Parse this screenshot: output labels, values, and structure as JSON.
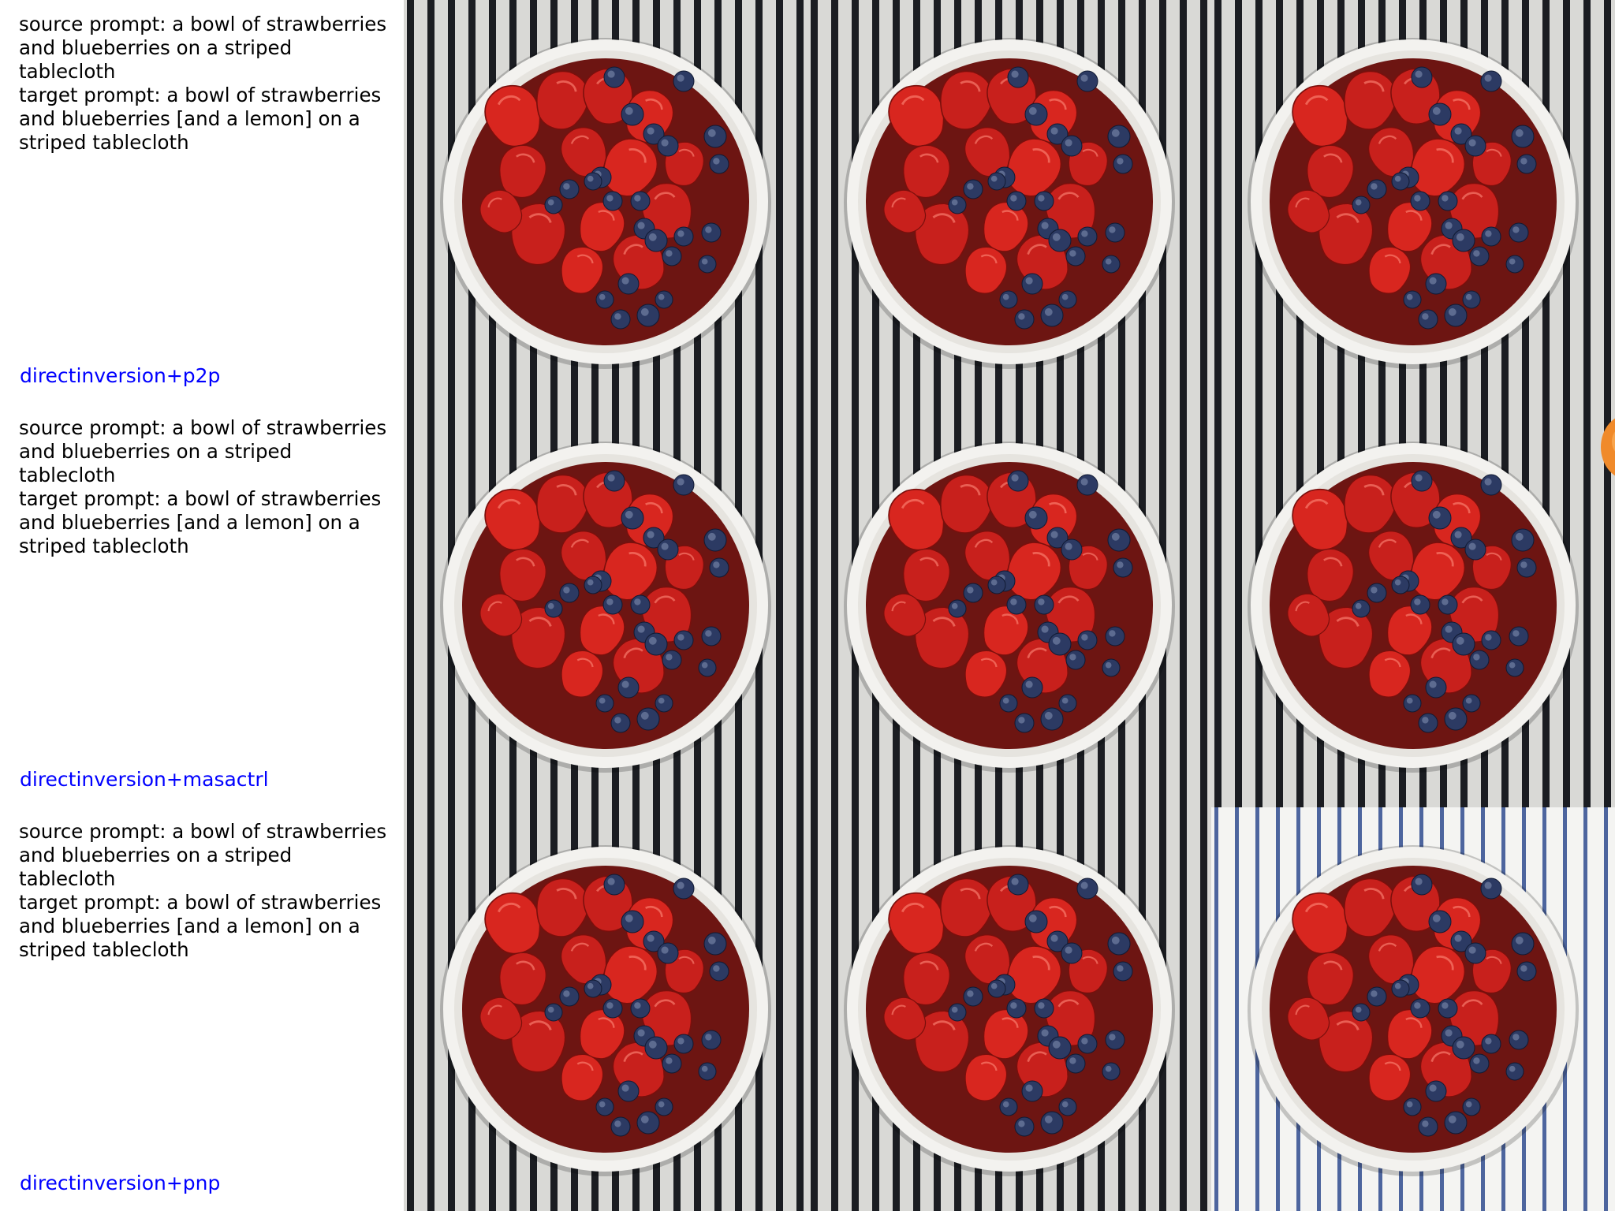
{
  "rows": [
    {
      "prompts": "source prompt: a bowl of strawberries\nand blueberries on a striped\ntablecloth\ntarget prompt: a bowl of strawberries\nand blueberries [and a lemon] on a\nstriped tablecloth",
      "method": "directinversion+p2p"
    },
    {
      "prompts": "source prompt: a bowl of strawberries\nand blueberries on a striped\ntablecloth\ntarget prompt: a bowl of strawberries\nand blueberries [and a lemon] on a\nstriped tablecloth",
      "method": "directinversion+masactrl"
    },
    {
      "prompts": "source prompt: a bowl of strawberries\nand blueberries on a striped\ntablecloth\ntarget prompt: a bowl of strawberries\nand blueberries [and a lemon] on a\nstriped tablecloth",
      "method": "directinversion+pnp"
    }
  ],
  "colors": {
    "stripe_dark": "#1b1d22",
    "stripe_light": "#d9d9d6",
    "stripe_blue": "#2f4b8f",
    "stripe_white": "#f4f4f2",
    "bowl": "#f3f2ef",
    "strawberry": "#c8201c",
    "blueberry": "#2c3a63",
    "lemon": "#f08a2a"
  },
  "images": [
    [
      "bowl-photo-dark-stripes",
      "bowl-photo-dark-stripes",
      "bowl-photo-dark-stripes"
    ],
    [
      "bowl-photo-dark-stripes",
      "bowl-photo-dark-stripes",
      "bowl-photo-dark-stripes-with-lemon"
    ],
    [
      "bowl-photo-dark-stripes",
      "bowl-photo-dark-stripes",
      "bowl-photo-blue-stripes"
    ]
  ]
}
